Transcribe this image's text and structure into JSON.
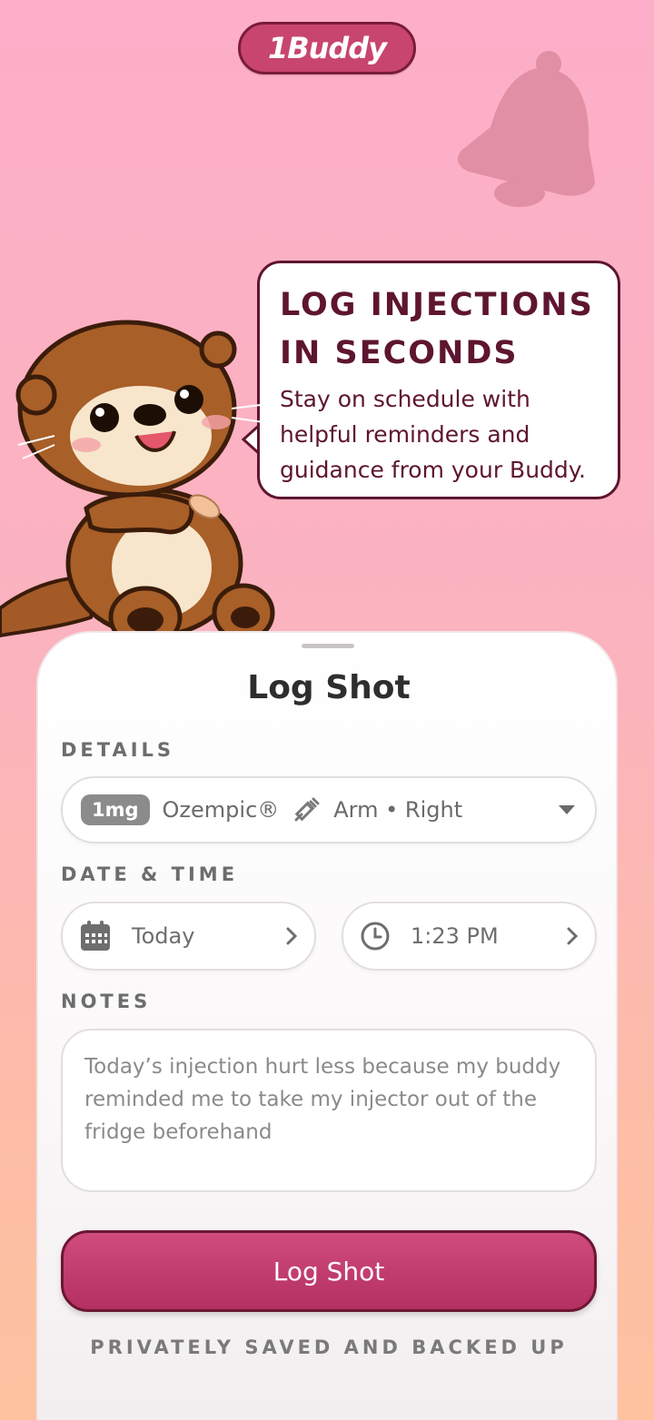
{
  "app": {
    "logo_text": "1Buddy"
  },
  "hero": {
    "title": "LOG INJECTIONS\nIN SECONDS",
    "subtitle": "Stay on schedule with helpful reminders and guidance from your Buddy."
  },
  "sheet": {
    "title": "Log Shot",
    "details_label": "DETAILS",
    "details": {
      "dose": "1mg",
      "medication": "Ozempic®",
      "site": "Arm • Right"
    },
    "datetime_label": "DATE & TIME",
    "date_value": "Today",
    "time_value": "1:23 PM",
    "notes_label": "NOTES",
    "notes_text": "Today’s injection hurt less because my buddy reminded me to take my injector out of the fridge beforehand",
    "button_label": "Log Shot",
    "footer": "PRIVATELY SAVED AND BACKED UP"
  },
  "icons": [
    "bell-icon",
    "syringe-icon",
    "caret-down-icon",
    "calendar-icon",
    "clock-icon",
    "chevron-right-icon"
  ],
  "colors": {
    "brand": "#c8456e",
    "dark_brand": "#5e1530",
    "button": "#b93468"
  }
}
